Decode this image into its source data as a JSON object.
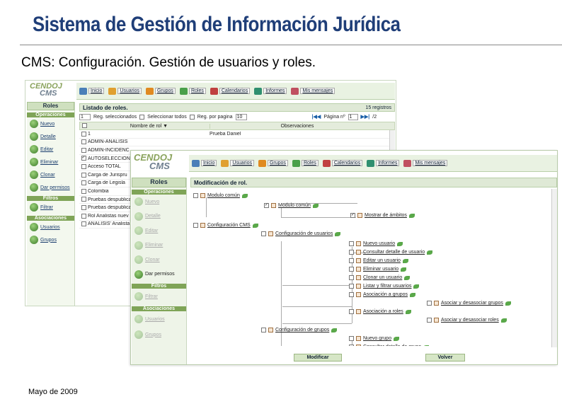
{
  "slide": {
    "title": "Sistema de Gestión de Información Jurídica",
    "subtitle": "CMS: Configuración. Gestión de usuarios y roles.",
    "footer": "Mayo de 2009"
  },
  "logo": {
    "line1": "CENDOJ",
    "line2": "CMS"
  },
  "nav": [
    "Inicio",
    "Usuarios",
    "Grupos",
    "Roles",
    "Calendarios",
    "Informes",
    "Mis mensajes"
  ],
  "back_window": {
    "sidebar": {
      "head": "Roles",
      "sections": [
        {
          "title": "Operaciones",
          "items": [
            "Nuevo",
            "Detalle",
            "Editar",
            "Eliminar",
            "Clonar",
            "Dar permisos"
          ]
        },
        {
          "title": "Filtros",
          "items": [
            "Filtrar"
          ]
        },
        {
          "title": "Asociaciones",
          "items": [
            "Usuarios",
            "Grupos"
          ]
        }
      ]
    },
    "panel_title": "Listado de roles.",
    "records": "15 registros",
    "toolbar": {
      "selected_count": "1",
      "selected_label": "Reg. seleccionados",
      "select_all": "Seleccionar todos",
      "per_page_label": "Reg. por pagina",
      "per_page": "10",
      "page_label": "Página nº",
      "page": "1",
      "page_total": "/2"
    },
    "columns": [
      "Nombre de rol ▼",
      "Observaciones"
    ],
    "rows": [
      {
        "name": "1",
        "obs": "Prueba Daniel"
      },
      {
        "name": "ADMIN-ANALISIS",
        "obs": ""
      },
      {
        "name": "ADMIN-INCIDENC",
        "obs": ""
      },
      {
        "name": "AUTOSELECCION",
        "obs": ""
      },
      {
        "name": "Acceso TOTAL",
        "obs": ""
      },
      {
        "name": "Carga de Jurispru",
        "obs": ""
      },
      {
        "name": "Carga de Legisla",
        "obs": ""
      },
      {
        "name": "Colombia",
        "obs": ""
      },
      {
        "name": "Pruebas despublica",
        "obs": ""
      },
      {
        "name": "Pruebas despublica Leg",
        "obs": ""
      },
      {
        "name": "Rol Analistas nuev",
        "obs": ""
      },
      {
        "name": "ANALISIS' Analista",
        "obs": ""
      }
    ]
  },
  "front_window": {
    "sidebar": {
      "head": "Roles",
      "sections": [
        {
          "title": "Operaciones",
          "items": [
            "Nuevo",
            "Detalle",
            "Editar",
            "Eliminar",
            "Clonar",
            "Dar permisos"
          ]
        },
        {
          "title": "Filtros",
          "items": [
            "Filtrar"
          ]
        },
        {
          "title": "Asociaciones",
          "items": [
            "Usuarios",
            "Grupos"
          ]
        }
      ]
    },
    "panel_title": "Modificación de rol.",
    "tree": [
      "Modulo común",
      "Modulo común",
      "Mostrar de ámbitos",
      "Configuración CMS",
      "Configuración de usuarios",
      "Nuevo usuario",
      "Consultar detalle de usuario",
      "Editar un usuario",
      "Eliminar usuario",
      "Clonar un usuario",
      "Listar y filtrar usuarios",
      "Asociación a grupos",
      "Asociar y desasociar grupos",
      "Asociación a roles",
      "Asociar y desasociar roles",
      "Configuración de grupos",
      "Nuevo grupo",
      "Consultar detalle de grupo"
    ],
    "buttons": {
      "modify": "Modificar",
      "back": "Volver"
    }
  }
}
